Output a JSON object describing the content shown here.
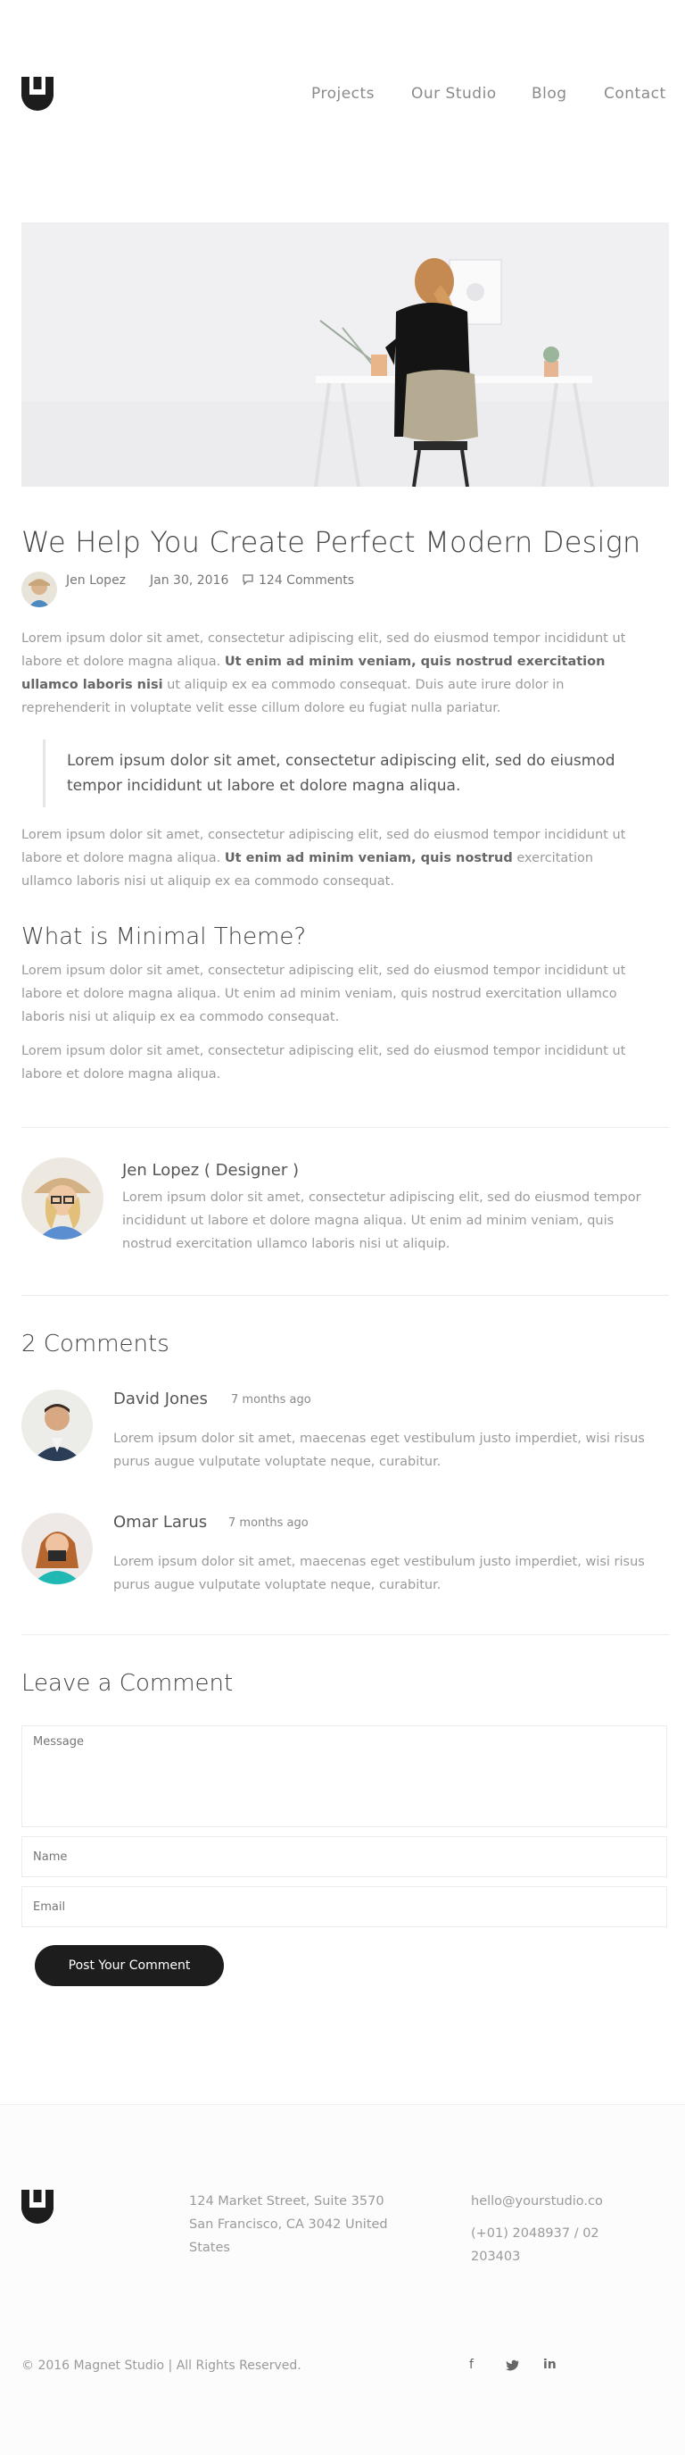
{
  "nav": {
    "items": [
      "Projects",
      "Our Studio",
      "Blog",
      "Contact"
    ]
  },
  "post": {
    "title": "We Help You Create Perfect Modern Design",
    "author": "Jen Lopez",
    "date": "Jan 30, 2016",
    "comments_link": "124 Comments",
    "para1_a": "Lorem ipsum dolor sit amet, consectetur adipiscing elit, sed do eiusmod tempor incididunt ut labore et dolore magna aliqua.",
    "para1_b": "Ut enim ad minim veniam, quis nostrud exercitation ullamco laboris nisi",
    "para1_c": "ut aliquip ex ea commodo consequat. Duis aute irure dolor in reprehenderit in voluptate velit esse cillum dolore eu fugiat nulla pariatur.",
    "quote": "Lorem ipsum dolor sit amet, consectetur adipiscing elit, sed do eiusmod tempor incididunt ut labore et dolore magna aliqua.",
    "para2_a": "Lorem ipsum dolor sit amet, consectetur adipiscing elit, sed do eiusmod tempor incididunt ut labore et dolore magna aliqua.",
    "para2_b": "Ut enim ad minim veniam, quis nostrud",
    "para2_c": "exercitation ullamco laboris nisi ut aliquip ex ea commodo consequat.",
    "subheading": "What is Minimal Theme?",
    "para3": "Lorem ipsum dolor sit amet, consectetur adipiscing elit, sed do eiusmod tempor incididunt ut labore et dolore magna aliqua. Ut enim ad minim veniam, quis nostrud exercitation ullamco laboris nisi ut aliquip ex ea commodo consequat.",
    "para4": "Lorem ipsum dolor sit amet, consectetur adipiscing elit, sed do eiusmod tempor incididunt ut labore et dolore magna aliqua."
  },
  "author_box": {
    "name": "Jen Lopez ( Designer )",
    "bio": "Lorem ipsum dolor sit amet, consectetur adipiscing elit, sed do eiusmod tempor incididunt ut labore et dolore magna aliqua. Ut enim ad minim veniam, quis nostrud exercitation ullamco laboris nisi ut aliquip."
  },
  "comments": {
    "heading": "2 Comments",
    "items": [
      {
        "name": "David Jones",
        "time": "7 months ago",
        "text": "Lorem ipsum dolor sit amet, maecenas eget vestibulum justo imperdiet, wisi risus purus augue vulputate voluptate neque, curabitur."
      },
      {
        "name": "Omar Larus",
        "time": "7 months ago",
        "text": "Lorem ipsum dolor sit amet, maecenas eget vestibulum justo imperdiet, wisi risus purus augue vulputate voluptate neque, curabitur."
      }
    ]
  },
  "form": {
    "heading": "Leave a Comment",
    "message_placeholder": "Message",
    "name_placeholder": "Name",
    "email_placeholder": "Email",
    "submit": "Post Your Comment"
  },
  "footer": {
    "address1": "124 Market Street, Suite 3570",
    "address2": "San Francisco, CA 3042 United",
    "address3": "States",
    "email": "hello@yourstudio.co",
    "phone1": "(+01) 2048937 / 02",
    "phone2": "203403",
    "copyright": "© 2016 Magnet Studio | All Rights Reserved.",
    "social": [
      "f",
      "twitter-icon",
      "in"
    ]
  }
}
